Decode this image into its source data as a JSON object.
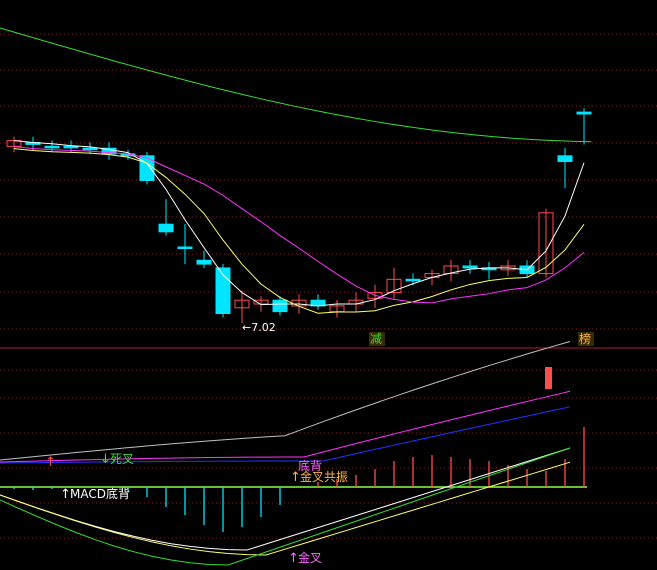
{
  "colors": {
    "background": "#000000",
    "grid": "#8a1a1a",
    "up": "#ff4d4d",
    "down": "#00e5ff",
    "ma_short": "#ffffff",
    "ma_mid": "#ffff66",
    "ma_long": "#ff33ff",
    "ma_longest": "#33dd33",
    "macd_dif": "#c0c0c0",
    "macd_dea": "#ff33ff",
    "macd_line3": "#2233ff",
    "kdj_k": "#ffffff",
    "kdj_d": "#ffff66",
    "kdj_j": "#33dd33",
    "zero": "#88ff44",
    "signal_buy": "#ff4d4d",
    "signal_sell": "#33dd33",
    "label_pink": "#ff66ff",
    "label_orange": "#ffb347"
  },
  "chart_data": [
    {
      "type": "candlestick",
      "panel": "price",
      "ylim": [
        0,
        1
      ],
      "annotation_low": "←7.02",
      "marker_labels": [
        {
          "text": "减",
          "x_index": 19,
          "color": "#33dd33"
        },
        {
          "text": "榜",
          "x_index": 30,
          "color": "#ffb347"
        }
      ],
      "candles": [
        {
          "o": 0.77,
          "h": 0.74,
          "l": 0.78,
          "c": 0.74
        },
        {
          "o": 0.75,
          "h": 0.74,
          "l": 0.77,
          "c": 0.76
        },
        {
          "o": 0.77,
          "h": 0.76,
          "l": 0.78,
          "c": 0.77
        },
        {
          "o": 0.77,
          "h": 0.76,
          "l": 0.78,
          "c": 0.77
        },
        {
          "o": 0.78,
          "h": 0.77,
          "l": 0.79,
          "c": 0.78
        },
        {
          "o": 0.78,
          "h": 0.77,
          "l": 0.82,
          "c": 0.81
        },
        {
          "o": 0.81,
          "h": 0.81,
          "l": 0.82,
          "c": 0.82
        },
        {
          "o": 0.82,
          "h": 0.82,
          "l": 0.95,
          "c": 0.95
        },
        {
          "o": 1.18,
          "h": 1.07,
          "l": 1.22,
          "c": 1.22
        },
        {
          "o": 1.3,
          "h": 1.2,
          "l": 1.37,
          "c": 1.3
        },
        {
          "o": 1.37,
          "h": 1.34,
          "l": 1.39,
          "c": 1.39
        },
        {
          "o": 1.41,
          "h": 1.41,
          "l": 1.65,
          "c": 1.65
        },
        {
          "o": 1.62,
          "h": 1.55,
          "l": 1.68,
          "c": 1.58
        },
        {
          "o": 1.6,
          "h": 1.58,
          "l": 1.62,
          "c": 1.58
        },
        {
          "o": 1.58,
          "h": 1.58,
          "l": 1.64,
          "c": 1.64
        },
        {
          "o": 1.61,
          "h": 1.57,
          "l": 1.63,
          "c": 1.58
        },
        {
          "o": 1.58,
          "h": 1.57,
          "l": 1.61,
          "c": 1.61
        },
        {
          "o": 1.64,
          "h": 1.6,
          "l": 1.65,
          "c": 1.61
        },
        {
          "o": 1.6,
          "h": 1.56,
          "l": 1.62,
          "c": 1.58
        },
        {
          "o": 1.57,
          "h": 1.52,
          "l": 1.6,
          "c": 1.54
        },
        {
          "o": 1.54,
          "h": 1.43,
          "l": 1.55,
          "c": 1.47
        },
        {
          "o": 1.47,
          "h": 1.46,
          "l": 1.48,
          "c": 1.47
        },
        {
          "o": 1.46,
          "h": 1.44,
          "l": 1.48,
          "c": 1.44
        },
        {
          "o": 1.44,
          "h": 1.39,
          "l": 1.46,
          "c": 1.4
        },
        {
          "o": 1.4,
          "h": 1.39,
          "l": 1.42,
          "c": 1.41
        },
        {
          "o": 1.41,
          "h": 1.4,
          "l": 1.45,
          "c": 1.42
        },
        {
          "o": 1.42,
          "h": 1.39,
          "l": 1.43,
          "c": 1.4
        },
        {
          "o": 1.4,
          "h": 1.39,
          "l": 1.44,
          "c": 1.44
        },
        {
          "o": 1.44,
          "h": 1.12,
          "l": 1.44,
          "c": 1.12
        },
        {
          "o": 0.82,
          "h": 0.8,
          "l": 0.97,
          "c": 0.85
        },
        {
          "o": 0.59,
          "h": 0.59,
          "l": 0.74,
          "c": 0.6
        }
      ]
    },
    {
      "type": "line",
      "panel": "macd",
      "labels": [
        {
          "text": "死叉",
          "arrow": "down",
          "x_index": 5,
          "color": "#33dd33"
        },
        {
          "text": "金叉共振",
          "arrow": "up",
          "x_index": 15,
          "color": "#ffb347"
        },
        {
          "text": "底背",
          "arrow": "none",
          "x_index": 16,
          "color": "#ff66ff"
        },
        {
          "text": "▲金叉",
          "arrow": "up",
          "x_index": 15,
          "color": "#ff66ff"
        }
      ]
    },
    {
      "type": "line",
      "panel": "kdj",
      "labels": [
        {
          "text": "MACD底背",
          "arrow": "up",
          "x_index": 3,
          "color": "#ffffff"
        },
        {
          "text": "金叉",
          "arrow": "up",
          "x_index": 15,
          "color": "#ff66ff"
        }
      ]
    }
  ]
}
